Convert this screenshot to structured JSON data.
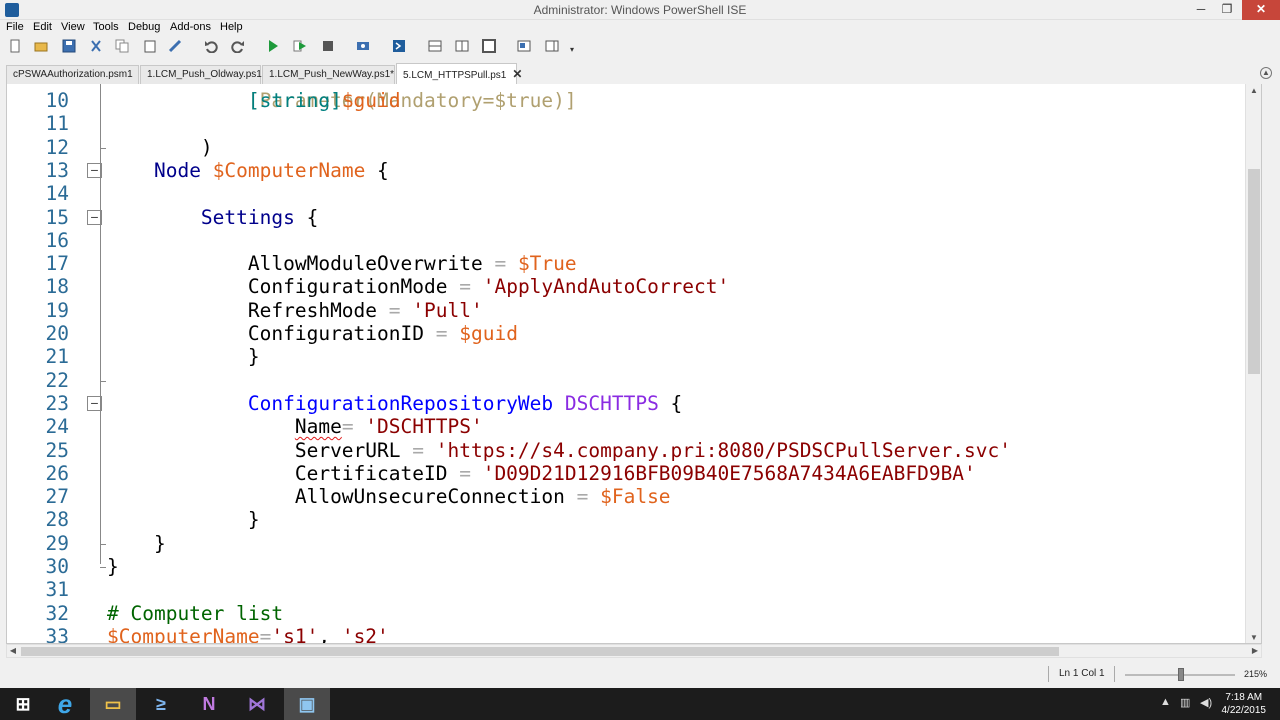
{
  "window": {
    "title": "Administrator: Windows PowerShell ISE",
    "min": "─",
    "max": "❐",
    "close": "✕"
  },
  "menu": [
    "File",
    "Edit",
    "View",
    "Tools",
    "Debug",
    "Add-ons",
    "Help"
  ],
  "toolbar_icons": [
    "new-icon",
    "open-icon",
    "save-icon",
    "cut-icon",
    "copy-icon",
    "paste-icon",
    "clear-icon",
    "undo-icon",
    "redo-icon",
    "run-icon",
    "run-selection-icon",
    "stop-icon",
    "new-remote-tab-icon",
    "start-powershell-icon",
    "show-script-top-icon",
    "show-script-right-icon",
    "show-script-max-icon",
    "show-command-window-icon",
    "show-command-addon-icon"
  ],
  "tabs": [
    {
      "label": "cPSWAAuthorization.psm1"
    },
    {
      "label": "1.LCM_Push_Oldway.ps1"
    },
    {
      "label": "1.LCM_Push_NewWay.ps1*"
    },
    {
      "label": "5.LCM_HTTPSPull.ps1",
      "close": "✕"
    }
  ],
  "editor": {
    "lines": [
      {
        "num": "10",
        "tokens": [
          {
            "t": "            ",
            "c": "plain"
          },
          {
            "t": "[string]",
            "c": "type"
          },
          {
            "t": "$guid",
            "c": "var"
          }
        ]
      },
      {
        "num": "11",
        "tokens": []
      },
      {
        "num": "12",
        "tokens": [
          {
            "t": "        )",
            "c": "plain"
          }
        ]
      },
      {
        "num": "13",
        "tokens": [
          {
            "t": "    ",
            "c": "plain"
          },
          {
            "t": "Node",
            "c": "kw"
          },
          {
            "t": " ",
            "c": "plain"
          },
          {
            "t": "$ComputerName",
            "c": "var"
          },
          {
            "t": " {",
            "c": "plain"
          }
        ]
      },
      {
        "num": "14",
        "tokens": []
      },
      {
        "num": "15",
        "tokens": [
          {
            "t": "        ",
            "c": "plain"
          },
          {
            "t": "Settings",
            "c": "kw"
          },
          {
            "t": " {",
            "c": "plain"
          }
        ]
      },
      {
        "num": "16",
        "tokens": []
      },
      {
        "num": "17",
        "tokens": [
          {
            "t": "            ",
            "c": "plain"
          },
          {
            "t": "AllowModuleOverwrite",
            "c": "plain"
          },
          {
            "t": " = ",
            "c": "op"
          },
          {
            "t": "$True",
            "c": "var"
          }
        ]
      },
      {
        "num": "18",
        "tokens": [
          {
            "t": "            ",
            "c": "plain"
          },
          {
            "t": "ConfigurationMode",
            "c": "plain"
          },
          {
            "t": " = ",
            "c": "op"
          },
          {
            "t": "'ApplyAndAutoCorrect'",
            "c": "str"
          }
        ]
      },
      {
        "num": "19",
        "tokens": [
          {
            "t": "            ",
            "c": "plain"
          },
          {
            "t": "RefreshMode",
            "c": "plain"
          },
          {
            "t": " = ",
            "c": "op"
          },
          {
            "t": "'Pull'",
            "c": "str"
          }
        ]
      },
      {
        "num": "20",
        "tokens": [
          {
            "t": "            ",
            "c": "plain"
          },
          {
            "t": "ConfigurationID",
            "c": "plain"
          },
          {
            "t": " = ",
            "c": "op"
          },
          {
            "t": "$guid",
            "c": "var"
          }
        ]
      },
      {
        "num": "21",
        "tokens": [
          {
            "t": "            }",
            "c": "plain"
          }
        ]
      },
      {
        "num": "22",
        "tokens": []
      },
      {
        "num": "23",
        "tokens": [
          {
            "t": "            ",
            "c": "plain"
          },
          {
            "t": "ConfigurationRepositoryWeb",
            "c": "cmd"
          },
          {
            "t": " ",
            "c": "plain"
          },
          {
            "t": "DSCHTTPS",
            "c": "arg"
          },
          {
            "t": " {",
            "c": "plain"
          }
        ]
      },
      {
        "num": "24",
        "tokens": [
          {
            "t": "                ",
            "c": "plain"
          },
          {
            "t": "Name",
            "c": "squig"
          },
          {
            "t": "= ",
            "c": "op"
          },
          {
            "t": "'DSCHTTPS'",
            "c": "str"
          }
        ]
      },
      {
        "num": "25",
        "tokens": [
          {
            "t": "                ",
            "c": "plain"
          },
          {
            "t": "ServerURL",
            "c": "plain"
          },
          {
            "t": " = ",
            "c": "op"
          },
          {
            "t": "'https://s4.company.pri:8080/PSDSCPullServer.svc'",
            "c": "str"
          }
        ]
      },
      {
        "num": "26",
        "tokens": [
          {
            "t": "                ",
            "c": "plain"
          },
          {
            "t": "CertificateID",
            "c": "plain"
          },
          {
            "t": " = ",
            "c": "op"
          },
          {
            "t": "'D09D21D12916BFB09B40E7568A7434A6EABFD9BA'",
            "c": "str"
          }
        ]
      },
      {
        "num": "27",
        "tokens": [
          {
            "t": "                ",
            "c": "plain"
          },
          {
            "t": "AllowUnsecureConnection",
            "c": "plain"
          },
          {
            "t": " = ",
            "c": "op"
          },
          {
            "t": "$False",
            "c": "var"
          }
        ]
      },
      {
        "num": "28",
        "tokens": [
          {
            "t": "            }",
            "c": "plain"
          }
        ]
      },
      {
        "num": "29",
        "tokens": [
          {
            "t": "    }",
            "c": "plain"
          }
        ]
      },
      {
        "num": "30",
        "tokens": [
          {
            "t": "}",
            "c": "plain"
          }
        ]
      },
      {
        "num": "31",
        "tokens": []
      },
      {
        "num": "32",
        "tokens": [
          {
            "t": "# Computer list",
            "c": "com"
          }
        ]
      },
      {
        "num": "33",
        "tokens": [
          {
            "t": "$ComputerName",
            "c": "var"
          },
          {
            "t": "=",
            "c": "op"
          },
          {
            "t": "'s1'",
            "c": "str"
          },
          {
            "t": ", ",
            "c": "plain"
          },
          {
            "t": "'s2'",
            "c": "str"
          }
        ]
      }
    ]
  },
  "status": {
    "position": "Ln 1  Col 1",
    "zoom": "215%"
  },
  "taskbar": {
    "apps": [
      "start-button",
      "internet-explorer",
      "file-explorer",
      "powershell",
      "onenote",
      "visual-studio",
      "powershell-ise"
    ],
    "start_glyph": "⊞",
    "ie_glyph": "e",
    "explorer_glyph": "▭",
    "ps_glyph": "≥",
    "onenote_glyph": "N",
    "vs_glyph": "⋈",
    "ise_glyph": "▣",
    "time": "7:18 AM",
    "date": "4/22/2015"
  }
}
